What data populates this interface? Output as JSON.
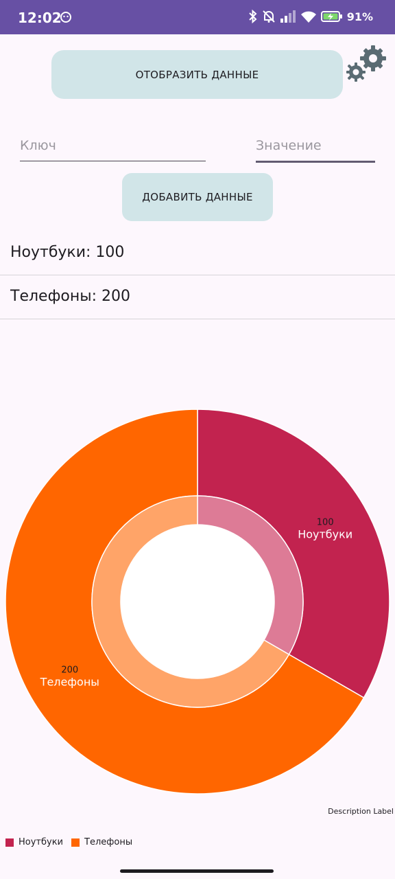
{
  "status_bar": {
    "time": "12:02",
    "battery": "91%",
    "background": "#6750a4"
  },
  "actions": {
    "show_label": "ОТОБРАЗИТЬ ДАННЫЕ",
    "add_label": "ДОБАВИТЬ ДАННЫЕ",
    "settings_icon": "gear-icon"
  },
  "inputs": {
    "key_placeholder": "Ключ",
    "key_value": "",
    "value_placeholder": "Значение",
    "value_value": ""
  },
  "list": [
    {
      "text": "Ноутбуки: 100"
    },
    {
      "text": "Телефоны: 200"
    }
  ],
  "chart_data": {
    "type": "pie",
    "categories": [
      "Ноутбуки",
      "Телефоны"
    ],
    "values": [
      100,
      200
    ],
    "colors": [
      "#c2234f",
      "#ff6600"
    ],
    "inner_colors": [
      "#dd7b96",
      "#ffa468"
    ],
    "description": "Description Label",
    "legend_position": "bottom-left"
  }
}
